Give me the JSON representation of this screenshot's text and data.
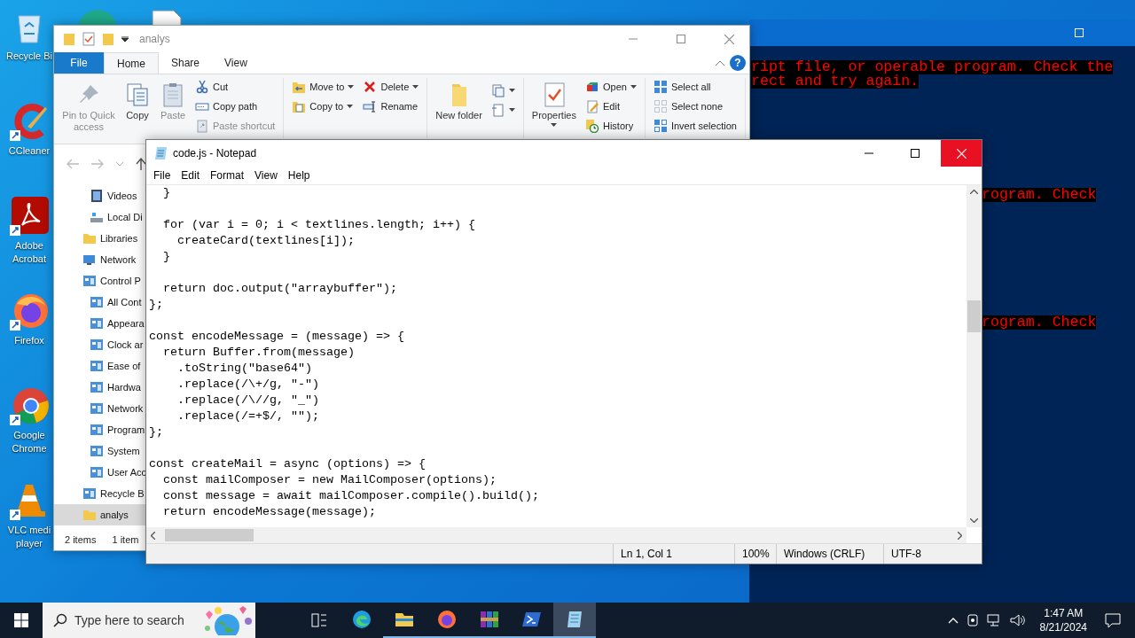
{
  "desktop_icons": [
    {
      "label_lines": [
        "Recycle Bi"
      ]
    },
    {
      "label_lines": [
        "CCleaner"
      ]
    },
    {
      "label_lines": [
        "Adobe",
        "Acrobat"
      ]
    },
    {
      "label_lines": [
        "Firefox"
      ]
    },
    {
      "label_lines": [
        "Google",
        "Chrome"
      ]
    },
    {
      "label_lines": [
        "VLC medi",
        "player"
      ]
    }
  ],
  "console": {
    "top_lines": [
      "ript file, or operable program. Check the",
      "rect and try again."
    ],
    "right_fragments": [
      "rogram. Check",
      "rogram. Check"
    ]
  },
  "explorer": {
    "title": "analys",
    "tabs": [
      {
        "label": "File",
        "kind": "file"
      },
      {
        "label": "Home",
        "kind": "tab",
        "selected": true
      },
      {
        "label": "Share",
        "kind": "tab",
        "selected": false
      },
      {
        "label": "View",
        "kind": "tab",
        "selected": false
      }
    ],
    "help": "?",
    "ribbon": [
      {
        "columns": [
          {
            "kind": "large",
            "label": "Pin to Quick access",
            "disabled": true,
            "dropdown": false
          },
          {
            "kind": "large",
            "label": "Copy",
            "disabled": false,
            "dropdown": false
          },
          {
            "kind": "large",
            "label": "Paste",
            "disabled": true,
            "dropdown": false
          },
          {
            "kind": "stack",
            "items": [
              {
                "label": "Cut",
                "disabled": false,
                "dropdown": false
              },
              {
                "label": "Copy path",
                "disabled": false,
                "dropdown": false
              },
              {
                "label": "Paste shortcut",
                "disabled": true,
                "dropdown": false
              }
            ]
          }
        ]
      },
      {
        "columns": [
          {
            "kind": "stack",
            "items": [
              {
                "label": "Move to",
                "disabled": false,
                "dropdown": true
              },
              {
                "label": "Copy to",
                "disabled": false,
                "dropdown": true
              }
            ]
          },
          {
            "kind": "stack",
            "items": [
              {
                "label": "Delete",
                "disabled": false,
                "dropdown": true
              },
              {
                "label": "Rename",
                "disabled": false,
                "dropdown": false
              }
            ]
          }
        ]
      },
      {
        "columns": [
          {
            "kind": "large",
            "label": "New folder",
            "disabled": false,
            "dropdown": false
          },
          {
            "kind": "icon_stack",
            "items": [
              {
                "dropdown": true
              },
              {
                "dropdown": true
              }
            ]
          }
        ]
      },
      {
        "columns": [
          {
            "kind": "large",
            "label": "Properties",
            "disabled": false,
            "dropdown": true
          },
          {
            "kind": "stack",
            "items": [
              {
                "label": "Open",
                "disabled": false,
                "dropdown": true
              },
              {
                "label": "Edit",
                "disabled": false,
                "dropdown": false
              },
              {
                "label": "History",
                "disabled": false,
                "dropdown": false
              }
            ]
          }
        ]
      },
      {
        "columns": [
          {
            "kind": "stack",
            "items": [
              {
                "label": "Select all",
                "disabled": false,
                "dropdown": false
              },
              {
                "label": "Select none",
                "disabled": false,
                "dropdown": false
              },
              {
                "label": "Invert selection",
                "disabled": false,
                "dropdown": false
              }
            ]
          }
        ]
      }
    ],
    "nav": {
      "scrolled_children": [
        {
          "label": "Videos",
          "selected": false
        },
        {
          "label": "Local Di",
          "selected": false
        }
      ],
      "items": [
        {
          "label": "Libraries",
          "selected": false
        },
        {
          "label": "Network",
          "selected": false
        },
        {
          "label": "Control P",
          "selected": false,
          "children": [
            {
              "label": "All Cont",
              "selected": false
            },
            {
              "label": "Appeara",
              "selected": false
            },
            {
              "label": "Clock ar",
              "selected": false
            },
            {
              "label": "Ease of",
              "selected": false
            },
            {
              "label": "Hardwa",
              "selected": false
            },
            {
              "label": "Network",
              "selected": false
            },
            {
              "label": "Program",
              "selected": false
            },
            {
              "label": "System",
              "selected": false
            },
            {
              "label": "User Acc",
              "selected": false
            }
          ]
        },
        {
          "label": "Recycle B",
          "selected": false
        },
        {
          "label": "analys",
          "selected": true
        }
      ]
    },
    "status": [
      "2 items",
      "1 item"
    ]
  },
  "notepad": {
    "title": "code.js - Notepad",
    "menu": [
      "File",
      "Edit",
      "Format",
      "View",
      "Help"
    ],
    "text": "  }\n\n  for (var i = 0; i < textlines.length; i++) {\n    createCard(textlines[i]);\n  }\n\n  return doc.output(\"arraybuffer\");\n};\n\nconst encodeMessage = (message) => {\n  return Buffer.from(message)\n    .toString(\"base64\")\n    .replace(/\\+/g, \"-\")\n    .replace(/\\//g, \"_\")\n    .replace(/=+$/, \"\");\n};\n\nconst createMail = async (options) => {\n  const mailComposer = new MailComposer(options);\n  const message = await mailComposer.compile().build();\n  return encodeMessage(message);",
    "status": [
      "Ln 1, Col 1",
      "100%",
      "Windows (CRLF)",
      "UTF-8"
    ]
  },
  "taskbar": {
    "search_placeholder": "Type here to search",
    "apps": [
      {
        "running": false,
        "active": false
      },
      {
        "running": true,
        "active": false
      },
      {
        "running": true,
        "active": false
      },
      {
        "running": true,
        "active": false
      },
      {
        "running": true,
        "active": false
      },
      {
        "running": true,
        "active": true
      }
    ],
    "time": "1:47 AM",
    "date": "8/21/2024"
  }
}
